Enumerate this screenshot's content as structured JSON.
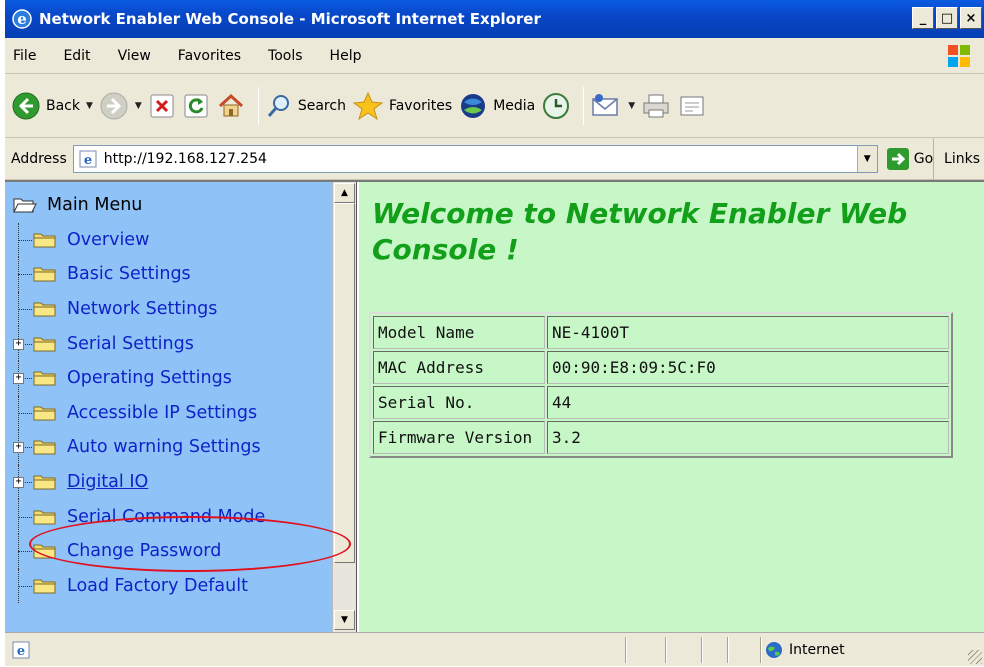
{
  "window": {
    "title": "Network Enabler Web Console - Microsoft Internet Explorer",
    "buttons": [
      "_",
      "□",
      "×"
    ]
  },
  "menubar": {
    "items": [
      "File",
      "Edit",
      "View",
      "Favorites",
      "Tools",
      "Help"
    ]
  },
  "toolbar": {
    "back_label": "Back",
    "search_label": "Search",
    "favorites_label": "Favorites",
    "media_label": "Media"
  },
  "addressbar": {
    "label": "Address",
    "url": "http://192.168.127.254",
    "go_label": "Go",
    "links_label": "Links"
  },
  "sidebar": {
    "root": "Main Menu",
    "items": [
      {
        "label": "Overview",
        "expandable": false
      },
      {
        "label": "Basic Settings",
        "expandable": false
      },
      {
        "label": "Network Settings",
        "expandable": false
      },
      {
        "label": "Serial Settings",
        "expandable": true
      },
      {
        "label": "Operating Settings",
        "expandable": true
      },
      {
        "label": "Accessible IP Settings",
        "expandable": false
      },
      {
        "label": "Auto warning Settings",
        "expandable": true
      },
      {
        "label": "Digital IO",
        "expandable": true
      },
      {
        "label": "Serial Command Mode",
        "expandable": false,
        "highlighted": true
      },
      {
        "label": "Change Password",
        "expandable": false
      },
      {
        "label": "Load Factory Default",
        "expandable": false
      }
    ]
  },
  "main": {
    "welcome_title": "Welcome to Network Enabler Web Console !",
    "info_table": [
      {
        "key": "Model Name",
        "value": "NE-4100T"
      },
      {
        "key": "MAC Address",
        "value": "00:90:E8:09:5C:F0"
      },
      {
        "key": "Serial No.",
        "value": "44"
      },
      {
        "key": "Firmware Version",
        "value": "3.2"
      }
    ]
  },
  "statusbar": {
    "zone_label": "Internet"
  },
  "colors": {
    "sidebar_bg": "#8fc3f7",
    "content_bg": "#c7f7c7",
    "title_green": "#12a01a",
    "link_blue": "#0e22c8",
    "highlight_red": "#e0101e"
  }
}
